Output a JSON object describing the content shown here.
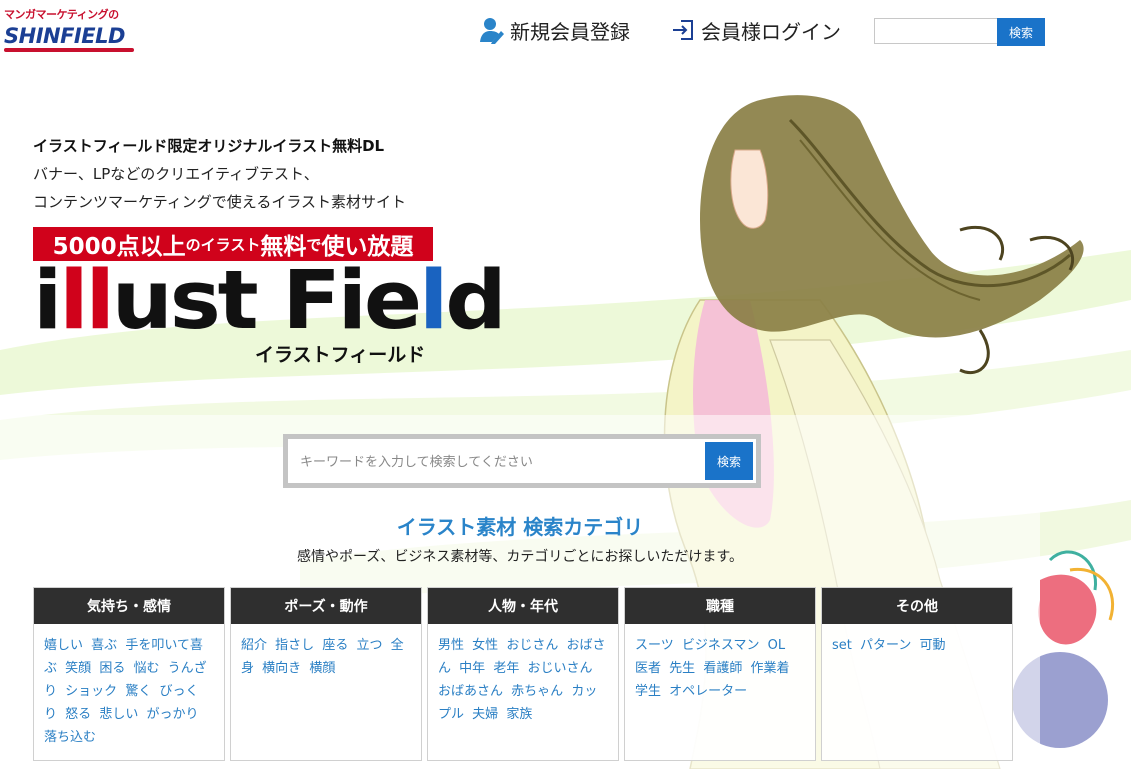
{
  "header": {
    "logo_top": "マンガマーケティングの",
    "logo_main": "SHINFIELD",
    "register_label": "新規会員登録",
    "login_label": "会員様ログイン",
    "search_button": "検索"
  },
  "hero": {
    "tagline_1": "イラストフィールド限定オリジナルイラスト無料DL",
    "tagline_2": "バナー、LPなどのクリエイティブテスト、",
    "tagline_3": "コンテンツマーケティングで使えるイラスト素材サイト",
    "banner_count": "5000点以上",
    "banner_mid": "のイラスト",
    "banner_free": "無料",
    "banner_mid2": "で",
    "banner_end": "使い放題",
    "brand_il": "i",
    "brand_ll": "ll",
    "brand_ust": "ust Fie",
    "brand_l": "l",
    "brand_d": "d",
    "brand_sub": "イラストフィールド"
  },
  "search": {
    "placeholder": "キーワードを入力して検索してください",
    "button": "検索"
  },
  "categories": {
    "heading": "イラスト素材 検索カテゴリ",
    "subtitle": "感情やポーズ、ビジネス素材等、カテゴリごとにお探しいただけます。",
    "groups": [
      {
        "title": "気持ち・感情",
        "tags": [
          "嬉しい",
          "喜ぶ",
          "手を叩いて喜ぶ",
          "笑顔",
          "困る",
          "悩む",
          "うんざり",
          "ショック",
          "驚く",
          "びっくり",
          "怒る",
          "悲しい",
          "がっかり",
          "落ち込む"
        ]
      },
      {
        "title": "ポーズ・動作",
        "tags": [
          "紹介",
          "指さし",
          "座る",
          "立つ",
          "全身",
          "横向き",
          "横顔"
        ]
      },
      {
        "title": "人物・年代",
        "tags": [
          "男性",
          "女性",
          "おじさん",
          "おばさん",
          "中年",
          "老年",
          "おじいさん",
          "おばあさん",
          "赤ちゃん",
          "カップル",
          "夫婦",
          "家族"
        ]
      },
      {
        "title": "職種",
        "tags": [
          "スーツ",
          "ビジネスマン",
          "OL",
          "医者",
          "先生",
          "看護師",
          "作業着",
          "学生",
          "オペレーター"
        ]
      },
      {
        "title": "その他",
        "tags": [
          "set",
          "パターン",
          "可動"
        ]
      }
    ]
  },
  "colors": {
    "brand_blue": "#1a73c9",
    "banner_red": "#d0021b",
    "heading_blue": "#2a84c9",
    "category_head": "#2f2f2f"
  }
}
